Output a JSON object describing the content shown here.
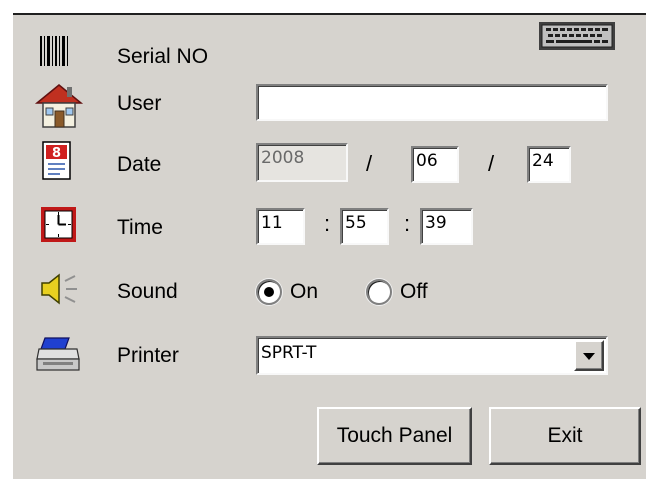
{
  "fields": {
    "serial_label": "Serial NO",
    "user_label": "User",
    "user_value": "",
    "date_label": "Date",
    "date_year": "2008",
    "date_sep": "/",
    "date_month": "06",
    "date_day": "24",
    "time_label": "Time",
    "time_sep": ":",
    "time_hour": "11",
    "time_minute": "55",
    "time_second": "39",
    "sound_label": "Sound",
    "sound_on": "On",
    "sound_off": "Off",
    "sound_selected": "On",
    "printer_label": "Printer",
    "printer_value": "SPRT-T"
  },
  "buttons": {
    "touch_panel": "Touch Panel",
    "exit": "Exit"
  },
  "icons": {
    "keyboard": "keyboard-icon",
    "serial": "barcode-icon",
    "user": "house-icon",
    "date": "calendar-icon",
    "time": "clock-icon",
    "sound": "speaker-icon",
    "printer": "printer-icon"
  }
}
